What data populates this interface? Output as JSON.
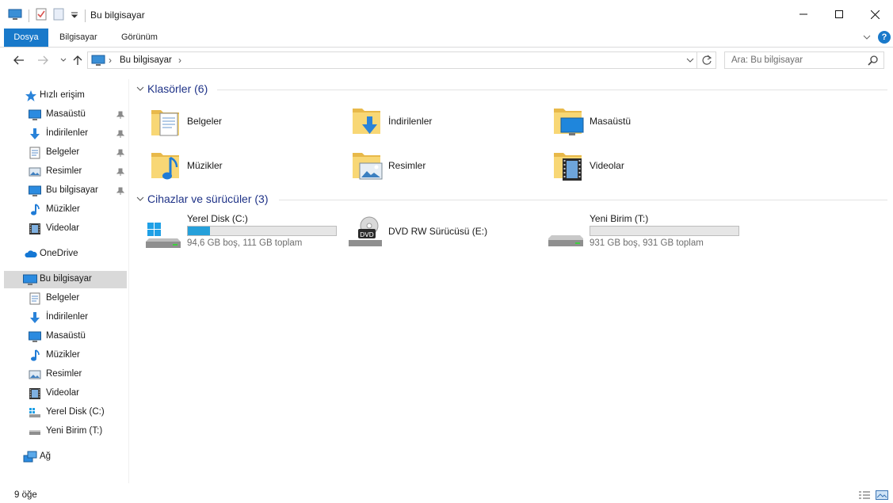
{
  "window": {
    "title": "Bu bilgisayar"
  },
  "ribbon": {
    "tabs": [
      "Dosya",
      "Bilgisayar",
      "Görünüm"
    ],
    "help": "?"
  },
  "address": {
    "crumb": "Bu bilgisayar",
    "separator": "›"
  },
  "search": {
    "placeholder": "Ara: Bu bilgisayar"
  },
  "sidebar": {
    "quick_access": "Hızlı erişim",
    "quick_items": [
      "Masaüstü",
      "İndirilenler",
      "Belgeler",
      "Resimler",
      "Bu bilgisayar",
      "Müzikler",
      "Videolar"
    ],
    "onedrive": "OneDrive",
    "this_pc": "Bu bilgisayar",
    "pc_items": [
      "Belgeler",
      "İndirilenler",
      "Masaüstü",
      "Müzikler",
      "Resimler",
      "Videolar",
      "Yerel Disk (C:)",
      "Yeni Birim (T:)"
    ],
    "network": "Ağ"
  },
  "groups": {
    "folders": "Klasörler (6)",
    "devices": "Cihazlar ve sürücüler (3)"
  },
  "folders": [
    "Belgeler",
    "İndirilenler",
    "Masaüstü",
    "Müzikler",
    "Resimler",
    "Videolar"
  ],
  "drives": [
    {
      "name": "Yerel Disk (C:)",
      "space": "94,6 GB boş, 111 GB toplam",
      "used_fraction": 0.15
    },
    {
      "name": "DVD RW Sürücüsü (E:)"
    },
    {
      "name": "Yeni Birim (T:)",
      "space": "931 GB boş, 931 GB toplam",
      "used_fraction": 0.0
    }
  ],
  "status": {
    "count": "9 öğe"
  },
  "colors": {
    "accent": "#1979ca",
    "selection": "#d9d9d9",
    "group_header": "#1e3287",
    "drive_fill": "#26a0da"
  }
}
